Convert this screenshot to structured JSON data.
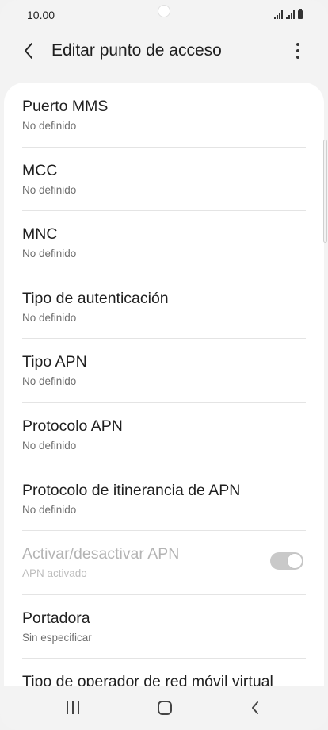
{
  "status_bar": {
    "time": "10.00"
  },
  "app_bar": {
    "title": "Editar punto de acceso"
  },
  "list": [
    {
      "title": "Puerto MMS",
      "subtitle": "No definido"
    },
    {
      "title": "MCC",
      "subtitle": "No definido"
    },
    {
      "title": "MNC",
      "subtitle": "No definido"
    },
    {
      "title": "Tipo de autenticación",
      "subtitle": "No definido"
    },
    {
      "title": "Tipo APN",
      "subtitle": "No definido"
    },
    {
      "title": "Protocolo APN",
      "subtitle": "No definido"
    },
    {
      "title": "Protocolo de itinerancia de APN",
      "subtitle": "No definido"
    },
    {
      "title": "Activar/desactivar APN",
      "subtitle": "APN activado",
      "toggle": "on",
      "disabled": true
    },
    {
      "title": "Portadora",
      "subtitle": "Sin especificar"
    },
    {
      "title": "Tipo de operador de red móvil virtual"
    }
  ],
  "icons": {
    "back": "chevron-left-icon",
    "more": "more-vertical-icon",
    "nav_recent": "recent-apps-icon",
    "nav_home": "home-icon",
    "nav_back": "back-icon"
  }
}
